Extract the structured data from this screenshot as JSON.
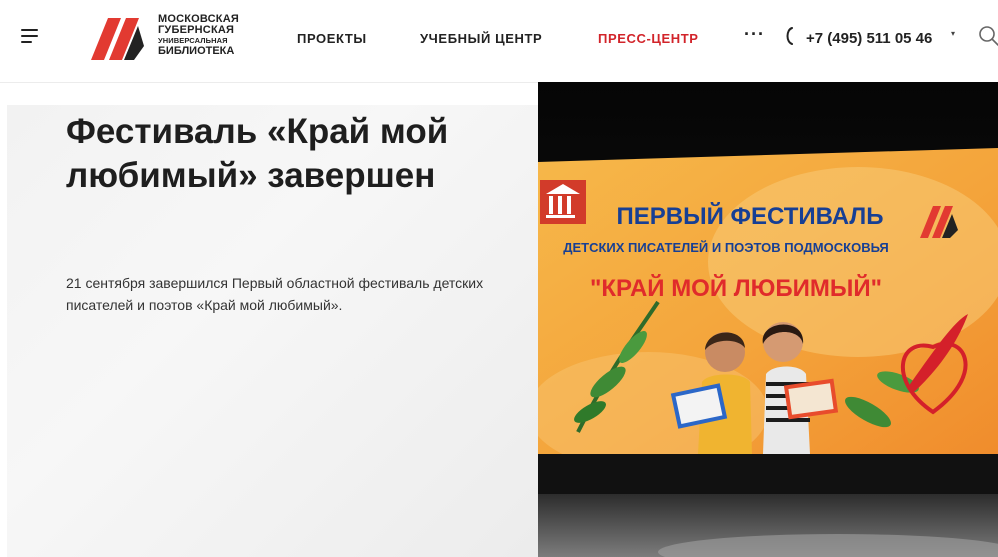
{
  "header": {
    "logo": {
      "line1": "МОСКОВСКАЯ",
      "line2": "ГУБЕРНСКАЯ",
      "line3": "УНИВЕРСАЛЬНАЯ",
      "line4": "БИБЛИОТЕКА"
    },
    "nav": [
      {
        "label": "ПРОЕКТЫ",
        "active": false
      },
      {
        "label": "УЧЕБНЫЙ ЦЕНТР",
        "active": false
      },
      {
        "label": "ПРЕСС-ЦЕНТР",
        "active": true
      }
    ],
    "more_label": "···",
    "phone": "+7 (495) 511 05 46",
    "icons": [
      "menu-icon",
      "phone-icon",
      "chevron-down-icon",
      "search-icon"
    ]
  },
  "article": {
    "title": "Фестиваль «Край мой любимый» завершен",
    "lead": "21 сентября завершился Первый областной фестиваль детских писателей и поэтов «Край мой любимый»."
  },
  "hero": {
    "screen_line1": "ПЕРВЫЙ ФЕСТИВАЛЬ",
    "screen_line2": "ДЕТСКИХ ПИСАТЕЛЕЙ И ПОЭТОВ ПОДМОСКОВЬЯ",
    "screen_line3": "\"КРАЙ МОЙ ЛЮБИМЫЙ\""
  },
  "colors": {
    "accent": "#d2242a",
    "text": "#222222",
    "screen_orange": "#f39a2c",
    "screen_title": "#173f94"
  }
}
